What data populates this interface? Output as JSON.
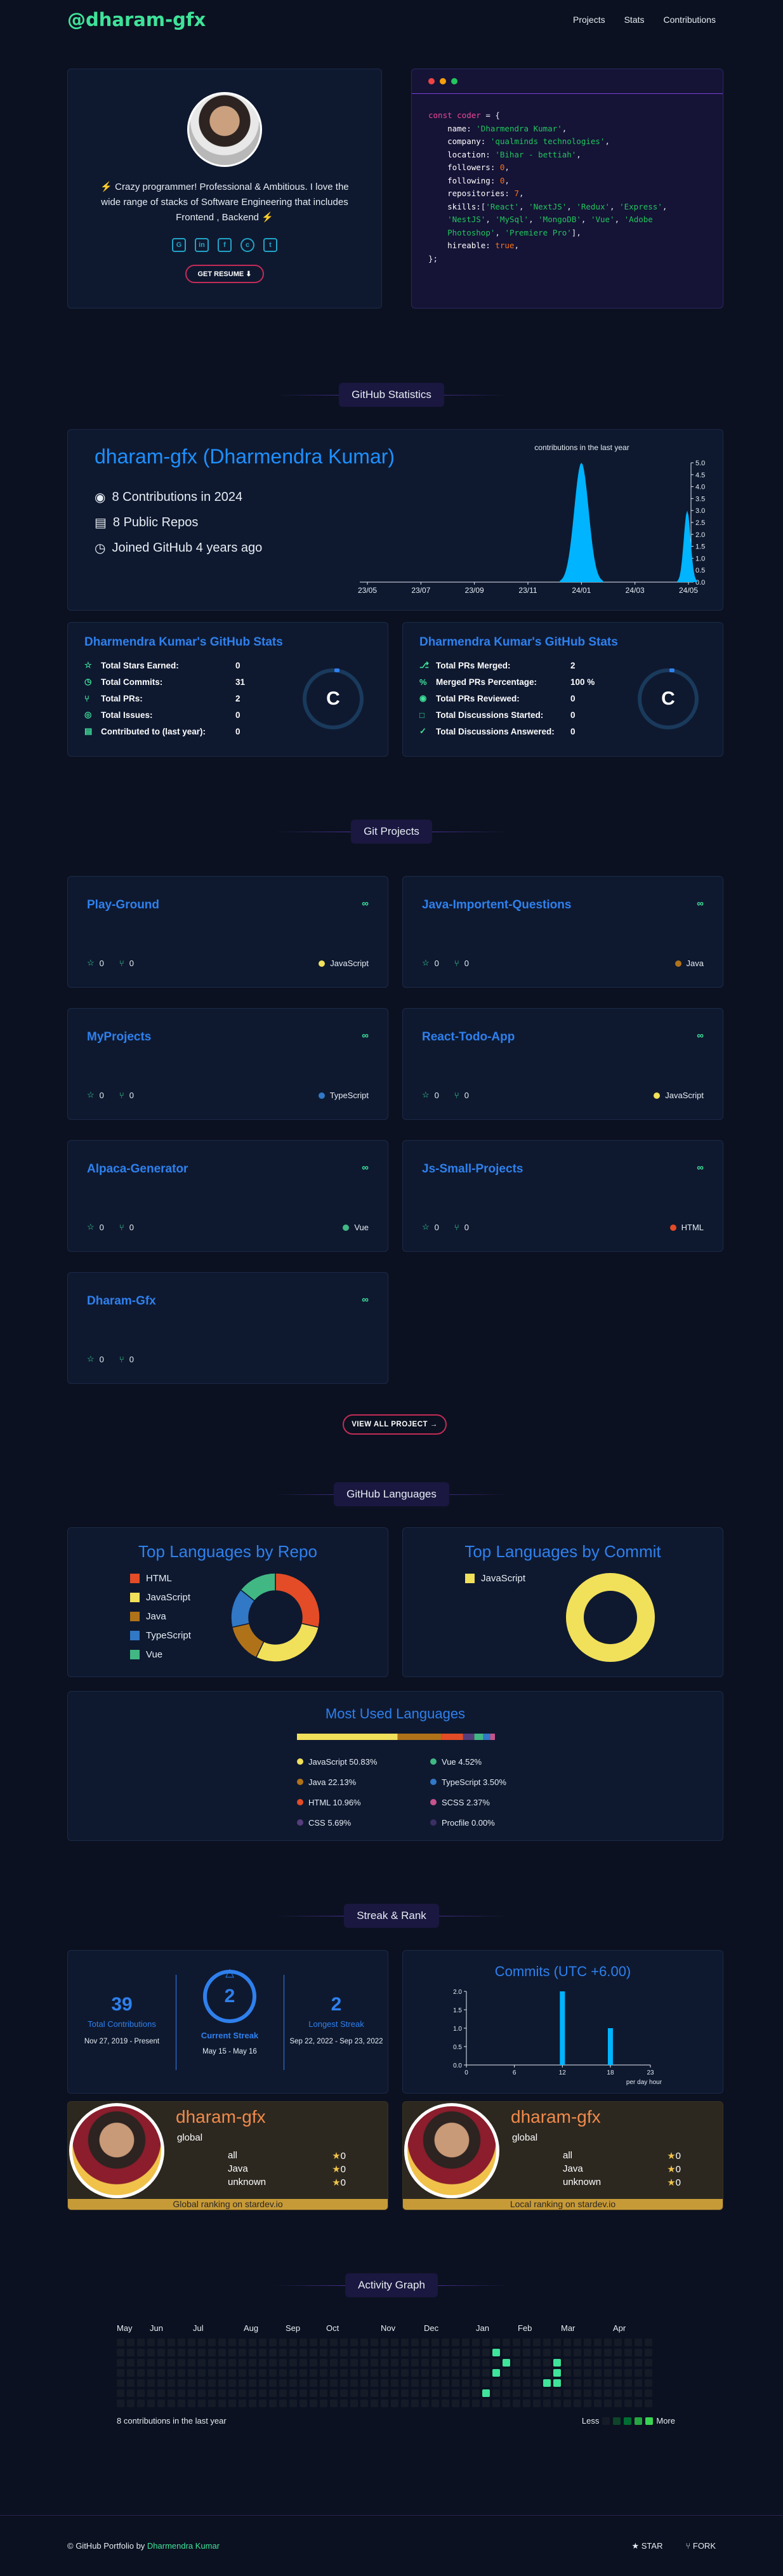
{
  "nav": {
    "logo": "@dharam-gfx",
    "links": [
      "Projects",
      "Stats",
      "Contributions"
    ]
  },
  "hero": {
    "bio": "⚡ Crazy programmer! Professional & Ambitious. I love the wide range of stacks of Software Engineering that includes Frontend , Backend ⚡",
    "socials": [
      "github-icon",
      "linkedin-icon",
      "facebook-icon",
      "codepen-icon",
      "twitter-icon"
    ],
    "resume_label": "GET RESUME ⬇"
  },
  "code": {
    "lines": [
      [
        [
          "k",
          "const "
        ],
        [
          "k",
          "coder"
        ],
        [
          "p",
          " = {"
        ]
      ],
      [
        [
          "pr",
          "    name: "
        ],
        [
          "s",
          "'Dharmendra Kumar'"
        ],
        [
          "p",
          ","
        ]
      ],
      [
        [
          "pr",
          "    company: "
        ],
        [
          "s",
          "'qualminds technologies'"
        ],
        [
          "p",
          ","
        ]
      ],
      [
        [
          "pr",
          "    location: "
        ],
        [
          "s",
          "'Bihar - bettiah'"
        ],
        [
          "p",
          ","
        ]
      ],
      [
        [
          "pr",
          "    followers: "
        ],
        [
          "n",
          "0"
        ],
        [
          "p",
          ","
        ]
      ],
      [
        [
          "pr",
          "    following: "
        ],
        [
          "n",
          "0"
        ],
        [
          "p",
          ","
        ]
      ],
      [
        [
          "pr",
          "    repositories: "
        ],
        [
          "n",
          "7"
        ],
        [
          "p",
          ","
        ]
      ],
      [
        [
          "pr",
          "    skills:"
        ],
        [
          "p",
          "["
        ],
        [
          "s",
          "'React'"
        ],
        [
          "p",
          ", "
        ],
        [
          "s",
          "'NextJS'"
        ],
        [
          "p",
          ", "
        ],
        [
          "s",
          "'Redux'"
        ],
        [
          "p",
          ", "
        ],
        [
          "s",
          "'Express'"
        ],
        [
          "p",
          ","
        ]
      ],
      [
        [
          "pr",
          "    "
        ],
        [
          "s",
          "'NestJS'"
        ],
        [
          "p",
          ", "
        ],
        [
          "s",
          "'MySql'"
        ],
        [
          "p",
          ", "
        ],
        [
          "s",
          "'MongoDB'"
        ],
        [
          "p",
          ", "
        ],
        [
          "s",
          "'Vue'"
        ],
        [
          "p",
          ", "
        ],
        [
          "s",
          "'Adobe"
        ]
      ],
      [
        [
          "pr",
          "    "
        ],
        [
          "s",
          "Photoshop'"
        ],
        [
          "p",
          ", "
        ],
        [
          "s",
          "'Premiere Pro'"
        ],
        [
          "p",
          "],"
        ]
      ],
      [
        [
          "pr",
          "    hireable: "
        ],
        [
          "n",
          "true"
        ],
        [
          "p",
          ","
        ]
      ],
      [
        [
          "p",
          "};"
        ]
      ]
    ]
  },
  "sections": {
    "stats": "GitHub Statistics",
    "projects": "Git Projects",
    "languages": "GitHub Languages",
    "streak": "Streak & Rank",
    "activity": "Activity Graph"
  },
  "github": {
    "name": "dharam-gfx (Dharmendra Kumar)",
    "contributions": "8 Contributions in 2024",
    "repos": "8 Public Repos",
    "joined": "Joined GitHub 4 years ago"
  },
  "chart_data": [
    {
      "type": "area",
      "title": "contributions in the last year",
      "x": [
        "23/05",
        "23/07",
        "23/09",
        "23/11",
        "24/01",
        "24/03",
        "24/05"
      ],
      "ylim": [
        0,
        5.0
      ],
      "y_ticks": [
        "0.0",
        "0.5",
        "1.0",
        "1.5",
        "2.0",
        "2.5",
        "3.0",
        "3.5",
        "4.0",
        "4.5",
        "5.0"
      ],
      "series": [
        {
          "points": [
            [
              "23/05",
              0
            ],
            [
              "23/07",
              0
            ],
            [
              "23/09",
              0
            ],
            [
              "23/11",
              0
            ],
            [
              "23/12",
              0
            ],
            [
              "24/01",
              5.0
            ],
            [
              "24/02",
              0
            ],
            [
              "24/03",
              0
            ],
            [
              "24/04",
              0
            ],
            [
              "24/05",
              3.0
            ]
          ]
        }
      ]
    },
    {
      "type": "bar",
      "title": "Commits (UTC +6.00)",
      "xlabel": "per day hour",
      "x_ticks": [
        "0",
        "6",
        "12",
        "18",
        "23"
      ],
      "y_ticks": [
        "0.0",
        "0.5",
        "1.0",
        "1.5",
        "2.0"
      ],
      "ylim": [
        0,
        2.0
      ],
      "values": [
        [
          12,
          2.0
        ],
        [
          18,
          1.0
        ]
      ]
    },
    {
      "type": "pie",
      "title": "Top Languages by Repo",
      "categories": [
        "HTML",
        "JavaScript",
        "Java",
        "TypeScript",
        "Vue"
      ],
      "values": [
        2,
        2,
        1,
        1,
        1
      ]
    },
    {
      "type": "pie",
      "title": "Top Languages by Commit",
      "categories": [
        "JavaScript"
      ],
      "values": [
        1
      ]
    },
    {
      "type": "bar",
      "title": "Most Used Languages",
      "categories": [
        "JavaScript",
        "Java",
        "HTML",
        "CSS",
        "Vue",
        "TypeScript",
        "SCSS",
        "Procfile"
      ],
      "values": [
        50.83,
        22.13,
        10.96,
        5.69,
        4.52,
        3.5,
        2.37,
        0.0
      ]
    }
  ],
  "stats_left": {
    "title": "Dharmendra Kumar's GitHub Stats",
    "rows": [
      {
        "icon": "star-icon",
        "label": "Total Stars Earned:",
        "value": "0"
      },
      {
        "icon": "clock-icon",
        "label": "Total Commits:",
        "value": "31"
      },
      {
        "icon": "pr-icon",
        "label": "Total PRs:",
        "value": "2"
      },
      {
        "icon": "issue-icon",
        "label": "Total Issues:",
        "value": "0"
      },
      {
        "icon": "repo-icon",
        "label": "Contributed to (last year):",
        "value": "0"
      }
    ],
    "grade": "C"
  },
  "stats_right": {
    "title": "Dharmendra Kumar's GitHub Stats",
    "rows": [
      {
        "icon": "merge-icon",
        "label": "Total PRs Merged:",
        "value": "2"
      },
      {
        "icon": "percent-icon",
        "label": "Merged PRs Percentage:",
        "value": "100 %"
      },
      {
        "icon": "eye-icon",
        "label": "Total PRs Reviewed:",
        "value": "0"
      },
      {
        "icon": "chat-icon",
        "label": "Total Discussions Started:",
        "value": "0"
      },
      {
        "icon": "check-icon",
        "label": "Total Discussions Answered:",
        "value": "0"
      }
    ],
    "grade": "C"
  },
  "projects": [
    {
      "name": "Play-Ground",
      "stars": "0",
      "forks": "0",
      "lang": "JavaScript",
      "color": "#f1e05a"
    },
    {
      "name": "Java-Importent-Questions",
      "stars": "0",
      "forks": "0",
      "lang": "Java",
      "color": "#b07219"
    },
    {
      "name": "MyProjects",
      "stars": "0",
      "forks": "0",
      "lang": "TypeScript",
      "color": "#3178c6"
    },
    {
      "name": "React-Todo-App",
      "stars": "0",
      "forks": "0",
      "lang": "JavaScript",
      "color": "#f1e05a"
    },
    {
      "name": "Alpaca-Generator",
      "stars": "0",
      "forks": "0",
      "lang": "Vue",
      "color": "#41b883"
    },
    {
      "name": "Js-Small-Projects",
      "stars": "0",
      "forks": "0",
      "lang": "HTML",
      "color": "#e34c26"
    },
    {
      "name": "Dharam-Gfx",
      "stars": "0",
      "forks": "0",
      "lang": "",
      "color": ""
    }
  ],
  "view_all": "VIEW ALL PROJECT →",
  "languages": {
    "repo_title": "Top Languages by Repo",
    "repo_legend": [
      {
        "name": "HTML",
        "color": "#e34c26"
      },
      {
        "name": "JavaScript",
        "color": "#f1e05a"
      },
      {
        "name": "Java",
        "color": "#b07219"
      },
      {
        "name": "TypeScript",
        "color": "#3178c6"
      },
      {
        "name": "Vue",
        "color": "#41b883"
      }
    ],
    "commit_title": "Top Languages by Commit",
    "commit_legend": [
      {
        "name": "JavaScript",
        "color": "#f1e05a"
      }
    ],
    "most_title": "Most Used Languages",
    "most": [
      {
        "label": "JavaScript 50.83%",
        "color": "#f1e05a"
      },
      {
        "label": "Vue 4.52%",
        "color": "#41b883"
      },
      {
        "label": "Java 22.13%",
        "color": "#b07219"
      },
      {
        "label": "TypeScript 3.50%",
        "color": "#3178c6"
      },
      {
        "label": "HTML 10.96%",
        "color": "#e34c26"
      },
      {
        "label": "SCSS 2.37%",
        "color": "#c6538c"
      },
      {
        "label": "CSS 5.69%",
        "color": "#563d7c"
      },
      {
        "label": "Procfile 0.00%",
        "color": "#3b2f63"
      }
    ]
  },
  "streak": {
    "total": "39",
    "total_label": "Total Contributions",
    "total_range": "Nov 27, 2019 - Present",
    "current": "2",
    "current_label": "Current Streak",
    "current_range": "May 15 - May 16",
    "longest": "2",
    "longest_label": "Longest Streak",
    "longest_range": "Sep 22, 2022 - Sep 23, 2022"
  },
  "commits_title": "Commits (UTC +6.00)",
  "commits_xlabel": "per day hour",
  "rank_cards": [
    {
      "name": "dharam-gfx",
      "sub": "global",
      "rows": [
        [
          "all",
          "0"
        ],
        [
          "Java",
          "0"
        ],
        [
          "unknown",
          "0"
        ]
      ],
      "foot": "Global ranking on stardev.io"
    },
    {
      "name": "dharam-gfx",
      "sub": "global",
      "rows": [
        [
          "all",
          "0"
        ],
        [
          "Java",
          "0"
        ],
        [
          "unknown",
          "0"
        ]
      ],
      "foot": "Local ranking on stardev.io"
    }
  ],
  "activity": {
    "months": [
      "May",
      "Jun",
      "Jul",
      "Aug",
      "Sep",
      "Oct",
      "Nov",
      "Dec",
      "Jan",
      "Feb",
      "Mar",
      "Apr"
    ],
    "caption": "8 contributions in the last year",
    "less": "Less",
    "more": "More"
  },
  "footer": {
    "prefix": "© GitHub Portfolio by ",
    "author": "Dharmendra Kumar",
    "star": "★  STAR",
    "fork": "⑂  FORK"
  },
  "colors": {
    "accent": "#3fe39a",
    "link": "#2f80ed",
    "bg": "#0b1120"
  }
}
